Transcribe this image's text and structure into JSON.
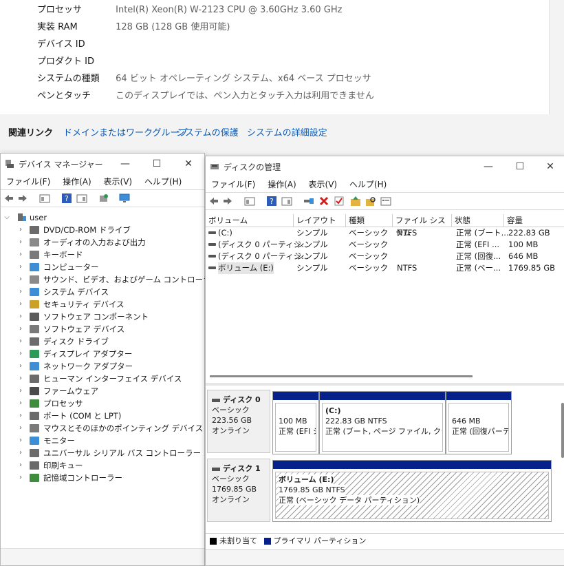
{
  "system": {
    "rows": [
      {
        "label": "プロセッサ",
        "value": "Intel(R) Xeon(R) W-2123 CPU @ 3.60GHz   3.60 GHz"
      },
      {
        "label": "実装 RAM",
        "value": "128 GB (128 GB 使用可能)"
      },
      {
        "label": "デバイス ID",
        "value": ""
      },
      {
        "label": "プロダクト ID",
        "value": ""
      },
      {
        "label": "システムの種類",
        "value": "64 ビット オペレーティング システム、x64 ベース プロセッサ"
      },
      {
        "label": "ペンとタッチ",
        "value": "このディスプレイでは、ペン入力とタッチ入力は利用できません"
      }
    ],
    "related": {
      "title": "関連リンク",
      "links": [
        "ドメインまたはワークグループ",
        "システムの保護",
        "システムの詳細設定"
      ]
    }
  },
  "device_manager": {
    "title": "デバイス マネージャー",
    "menu": [
      "ファイル(F)",
      "操作(A)",
      "表示(V)",
      "ヘルプ(H)"
    ],
    "root": "user",
    "items": [
      {
        "label": "DVD/CD-ROM ドライブ",
        "icon": "dvd-drive-icon",
        "color": "#6b6b6b"
      },
      {
        "label": "オーディオの入力および出力",
        "icon": "speaker-icon",
        "color": "#8a8a8a"
      },
      {
        "label": "キーボード",
        "icon": "keyboard-icon",
        "color": "#7a7a7a"
      },
      {
        "label": "コンピューター",
        "icon": "computer-icon",
        "color": "#3c8fd6"
      },
      {
        "label": "サウンド、ビデオ、およびゲーム コントローラー",
        "icon": "speaker-icon",
        "color": "#8a8a8a"
      },
      {
        "label": "システム デバイス",
        "icon": "system-folder-icon",
        "color": "#3c8fd6"
      },
      {
        "label": "セキュリティ デバイス",
        "icon": "security-key-icon",
        "color": "#c9a227"
      },
      {
        "label": "ソフトウェア コンポーネント",
        "icon": "software-component-icon",
        "color": "#5a5a5a"
      },
      {
        "label": "ソフトウェア デバイス",
        "icon": "software-device-icon",
        "color": "#7a7a7a"
      },
      {
        "label": "ディスク ドライブ",
        "icon": "disk-drive-icon",
        "color": "#6b6b6b"
      },
      {
        "label": "ディスプレイ アダプター",
        "icon": "display-adapter-icon",
        "color": "#2e9a57"
      },
      {
        "label": "ネットワーク アダプター",
        "icon": "network-adapter-icon",
        "color": "#3c8fd6"
      },
      {
        "label": "ヒューマン インターフェイス デバイス",
        "icon": "hid-icon",
        "color": "#6b6b6b"
      },
      {
        "label": "ファームウェア",
        "icon": "firmware-icon",
        "color": "#4a4a4a"
      },
      {
        "label": "プロセッサ",
        "icon": "processor-icon",
        "color": "#3f8c3f"
      },
      {
        "label": "ポート (COM と LPT)",
        "icon": "port-icon",
        "color": "#6b6b6b"
      },
      {
        "label": "マウスとそのほかのポインティング デバイス",
        "icon": "mouse-icon",
        "color": "#7a7a7a"
      },
      {
        "label": "モニター",
        "icon": "monitor-icon",
        "color": "#3c8fd6"
      },
      {
        "label": "ユニバーサル シリアル バス コントローラー",
        "icon": "usb-icon",
        "color": "#6b6b6b"
      },
      {
        "label": "印刷キュー",
        "icon": "printer-icon",
        "color": "#6b6b6b"
      },
      {
        "label": "記憶域コントローラー",
        "icon": "storage-controller-icon",
        "color": "#3f8c3f"
      }
    ]
  },
  "disk_management": {
    "title": "ディスクの管理",
    "menu": [
      "ファイル(F)",
      "操作(A)",
      "表示(V)",
      "ヘルプ(H)"
    ],
    "columns": [
      "ボリューム",
      "レイアウト",
      "種類",
      "ファイル システム",
      "状態",
      "容量"
    ],
    "volumes": [
      [
        "(C:)",
        "シンプル",
        "ベーシック",
        "NTFS",
        "正常 (ブート...",
        "222.83 GB"
      ],
      [
        "(ディスク 0 パーティシ...",
        "シンプル",
        "ベーシック",
        "",
        "正常 (EFI ...",
        "100 MB"
      ],
      [
        "(ディスク 0 パーティシ...",
        "シンプル",
        "ベーシック",
        "",
        "正常 (回復...",
        "646 MB"
      ],
      [
        "ボリューム (E:)",
        "シンプル",
        "ベーシック",
        "NTFS",
        "正常 (ベー...",
        "1769.85 GB"
      ]
    ],
    "disks": [
      {
        "name": "ディスク 0",
        "type": "ベーシック",
        "size": "223.56 GB",
        "status": "オンライン",
        "partitions": [
          {
            "title": "",
            "size": "100 MB",
            "status": "正常 (EFI シ"
          },
          {
            "title": "(C:)",
            "size": "222.83 GB NTFS",
            "status": "正常 (ブート, ページ ファイル, クラッシ"
          },
          {
            "title": "",
            "size": "646 MB",
            "status": "正常 (回復パーテ"
          }
        ]
      },
      {
        "name": "ディスク 1",
        "type": "ベーシック",
        "size": "1769.85 GB",
        "status": "オンライン",
        "partitions": [
          {
            "title": "ボリューム  (E:)",
            "size": "1769.85 GB NTFS",
            "status": "正常 (ベーシック データ パーティション)"
          }
        ]
      }
    ],
    "legend": [
      {
        "label": "未割り当て",
        "color": "#000000"
      },
      {
        "label": "プライマリ パーティション",
        "color": "#06208c"
      }
    ]
  },
  "colors": {
    "primary_partition": "#06208c",
    "link": "#0a5bb5"
  }
}
